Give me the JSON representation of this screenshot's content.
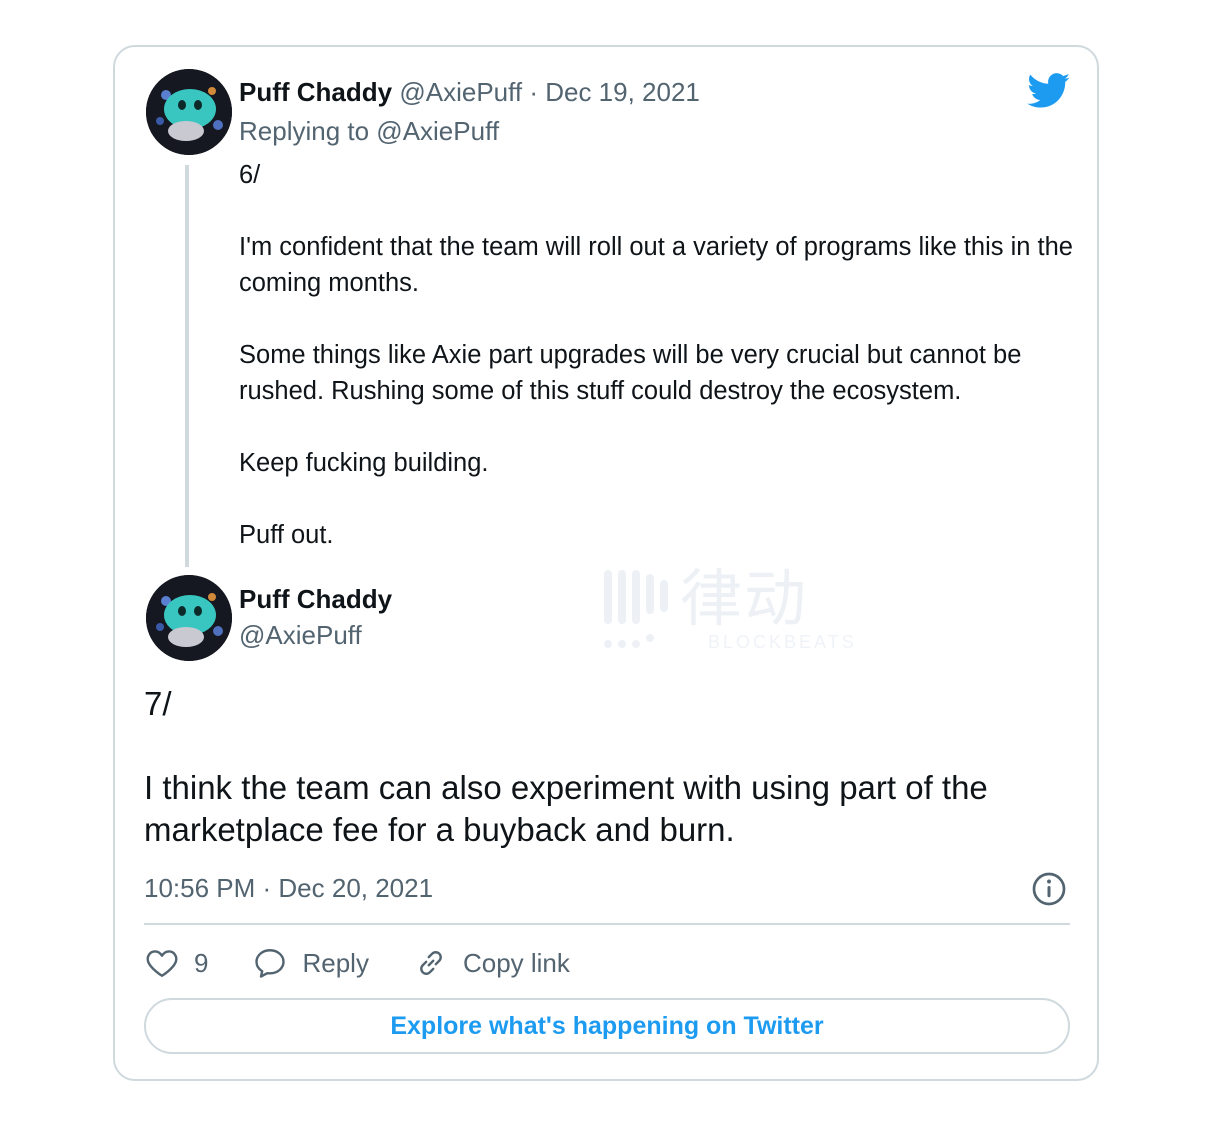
{
  "tweet1": {
    "name": "Puff Chaddy",
    "handle": "@AxiePuff",
    "separator": " · ",
    "date": "Dec 19, 2021",
    "replying_to": "Replying to @AxiePuff",
    "text": "6/\n\nI'm confident that the team will roll out a variety of programs like this in the coming months.\n\nSome things like Axie part upgrades will be very crucial but cannot be rushed. Rushing some of this stuff could destroy the ecosystem.\n\nKeep fucking building.\n\nPuff out."
  },
  "tweet2": {
    "name": "Puff Chaddy",
    "handle": "@AxiePuff",
    "text": "7/\n\nI think the team can also experiment with using part of the marketplace fee for a buyback and burn.",
    "timestamp": "10:56 PM · Dec 20, 2021"
  },
  "actions": {
    "like_count": "9",
    "reply_label": "Reply",
    "copy_label": "Copy link"
  },
  "explore_label": "Explore what's happening on Twitter",
  "watermark": {
    "cn": "律动",
    "en": "BLOCKBEATS"
  },
  "icons": [
    "twitter-bird-icon",
    "info-icon",
    "heart-icon",
    "reply-bubble-icon",
    "link-icon"
  ],
  "colors": {
    "accent": "#1d9bf0",
    "muted": "#536471",
    "border": "#cfd9de",
    "text": "#0f1419"
  }
}
